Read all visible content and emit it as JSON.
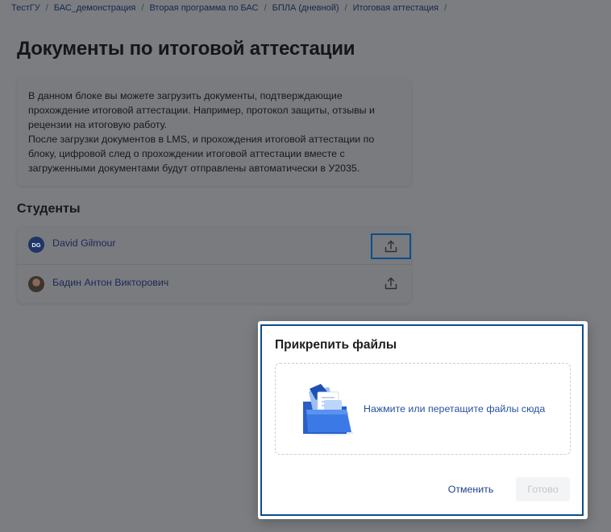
{
  "breadcrumb": [
    "ТестГУ",
    "БАС_демонстрация",
    "Вторая программа по БАС",
    "БПЛА (дневной)",
    "Итоговая аттестация"
  ],
  "page_title": "Документы по итоговой аттестации",
  "info_text": "В данном блоке вы можете загрузить документы, подтверждающие\nпрохождение итоговой аттестации. Например, протокол защиты, отзывы и\nрецензии на итоговую работу.\nПосле загрузки документов в LMS, и прохождения итоговой аттестации по\nблоку, цифровой след о прохождении итоговой аттестации вместе с\nзагруженными документами будут отправлены автоматически в У2035.",
  "students_title": "Студенты",
  "students": [
    {
      "initials": "DG",
      "name": "David Gilmour",
      "upload_icon": "upload-icon"
    },
    {
      "initials": "",
      "name": "Бадин Антон Викторович",
      "upload_icon": "upload-icon"
    }
  ],
  "modal": {
    "title": "Прикрепить файлы",
    "dropzone_text": "Нажмите или перетащите файлы сюда",
    "dropzone_icon": "folder-icon",
    "cancel_label": "Отменить",
    "done_label": "Готово"
  },
  "colors": {
    "accent": "#2851a3",
    "focus_outline": "#0b4d8c",
    "overlay": "#7b7d81"
  }
}
